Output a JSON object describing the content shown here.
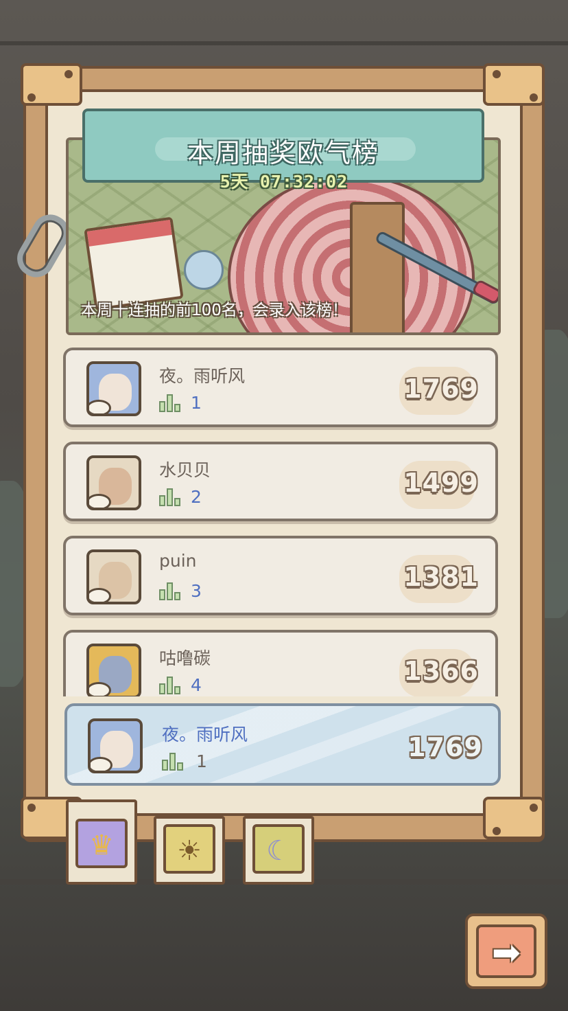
{
  "title": "本周抽奖欧气榜",
  "countdown": "5天 07:32:02",
  "banner_note": "本周十连抽的前100名，会录入该榜！",
  "leaderboard": [
    {
      "name": "夜。雨听风",
      "rank": "1",
      "score": "1769",
      "avatar": "blue-hair-avatar"
    },
    {
      "name": "水贝贝",
      "rank": "2",
      "score": "1499",
      "avatar": "mustache-man-avatar"
    },
    {
      "name": "puin",
      "rank": "3",
      "score": "1381",
      "avatar": "bald-man-avatar"
    },
    {
      "name": "咕噜碳",
      "rank": "4",
      "score": "1366",
      "avatar": "creature-avatar"
    }
  ],
  "my_entry": {
    "name": "夜。雨听风",
    "rank": "1",
    "score": "1769",
    "avatar": "blue-hair-avatar"
  },
  "tabs": [
    {
      "icon": "crown-icon",
      "selected": true
    },
    {
      "icon": "sun-face-icon",
      "selected": false
    },
    {
      "icon": "moon-face-icon",
      "selected": false
    }
  ],
  "next_button_icon": "arrow-right-icon",
  "colors": {
    "title_plaque": "#8fcac1",
    "my_entry_bg": "#cfe1ec",
    "rank_number": "#4f6fc0",
    "frame_wood": "#c99f72"
  }
}
